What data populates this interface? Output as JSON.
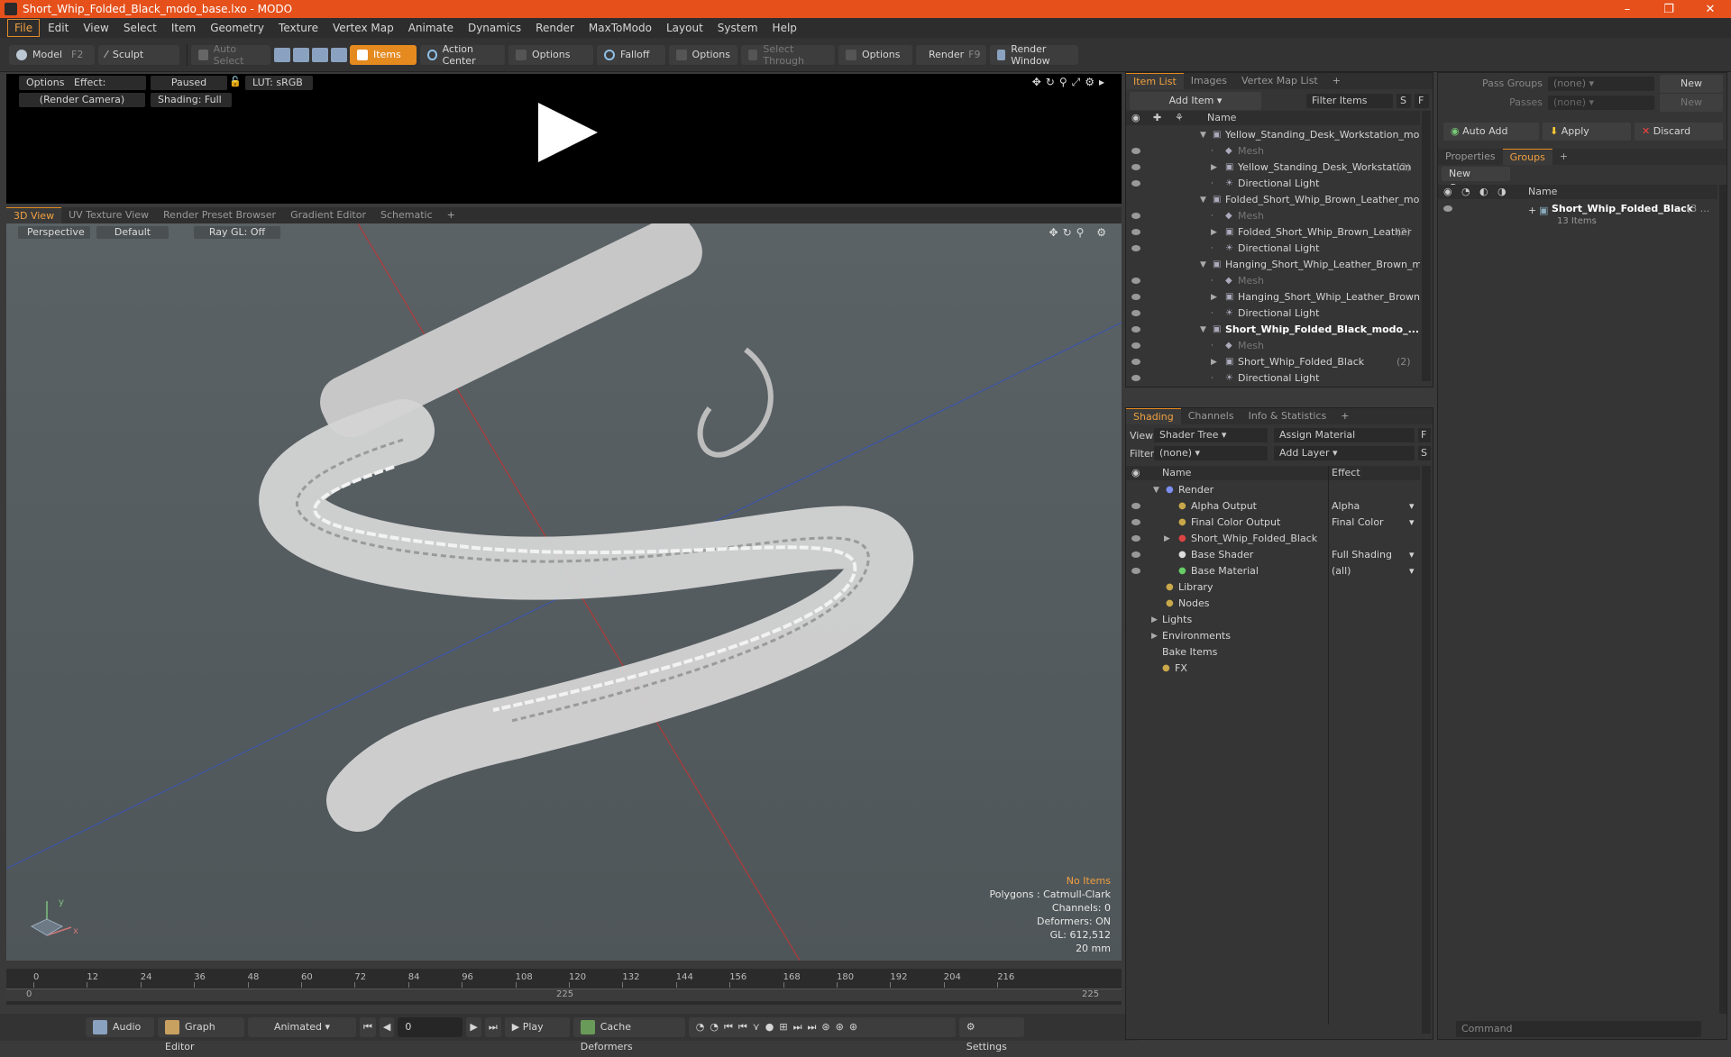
{
  "window": {
    "title": "Short_Whip_Folded_Black_modo_base.lxo - MODO",
    "controls": [
      "–",
      "❐",
      "✕"
    ]
  },
  "menu": [
    "File",
    "Edit",
    "View",
    "Select",
    "Item",
    "Geometry",
    "Texture",
    "Vertex Map",
    "Animate",
    "Dynamics",
    "Render",
    "MaxToModo",
    "Layout",
    "System",
    "Help"
  ],
  "toolbar": {
    "model": "Model",
    "model_key": "F2",
    "sculpt": "Sculpt",
    "auto_select": "Auto Select",
    "items": "Items",
    "action_center": "Action Center",
    "options1": "Options",
    "falloff": "Falloff",
    "options2": "Options",
    "select_through": "Select Through",
    "options3": "Options",
    "render": "Render",
    "render_key": "F9",
    "render_window": "Render Window"
  },
  "preview": {
    "options": "Options",
    "effect": "Effect: (Shadi...",
    "paused": "Paused",
    "lut": "LUT: sRGB",
    "camera": "(Render Camera)",
    "shading": "Shading: Full"
  },
  "view_tabs": [
    "3D View",
    "UV Texture View",
    "Render Preset Browser",
    "Gradient Editor",
    "Schematic",
    "+"
  ],
  "viewport": {
    "perspective": "Perspective",
    "default": "Default",
    "raygl": "Ray GL: Off",
    "stats": {
      "no_items": "No Items",
      "polygons": "Polygons : Catmull-Clark",
      "channels": "Channels: 0",
      "deformers": "Deformers: ON",
      "gl": "GL: 612,512",
      "scale": "20 mm"
    },
    "axis_x": "x",
    "axis_y": "y"
  },
  "timeline": {
    "ticks": [
      "0",
      "12",
      "24",
      "36",
      "48",
      "60",
      "72",
      "84",
      "96",
      "108",
      "120",
      "132",
      "144",
      "156",
      "168",
      "180",
      "192",
      "204",
      "216"
    ],
    "start": "0",
    "mid": "225",
    "end": "225"
  },
  "bottom": {
    "audio": "Audio",
    "graph_editor": "Graph Editor",
    "animated": "Animated",
    "frame": "0",
    "play": "Play",
    "cache_deformers": "Cache Deformers",
    "settings": "Settings"
  },
  "item_list": {
    "tabs": [
      "Item List",
      "Images",
      "Vertex Map List",
      "+"
    ],
    "add_item": "Add Item",
    "filter_items": "Filter Items",
    "s": "S",
    "f": "F",
    "col_name": "Name",
    "rows": [
      {
        "label": "Yellow_Standing_Desk_Workstation_mo ...",
        "indent": 1,
        "kind": "scene"
      },
      {
        "label": "Mesh",
        "indent": 2,
        "kind": "mesh"
      },
      {
        "label": "Yellow_Standing_Desk_Workstation",
        "count": "(2)",
        "indent": 2,
        "kind": "group"
      },
      {
        "label": "Directional Light",
        "indent": 2,
        "kind": "light"
      },
      {
        "label": "Folded_Short_Whip_Brown_Leather_mo ...",
        "indent": 1,
        "kind": "scene"
      },
      {
        "label": "Mesh",
        "indent": 2,
        "kind": "mesh"
      },
      {
        "label": "Folded_Short_Whip_Brown_Leather",
        "count": "(2)",
        "indent": 2,
        "kind": "group"
      },
      {
        "label": "Directional Light",
        "indent": 2,
        "kind": "light"
      },
      {
        "label": "Hanging_Short_Whip_Leather_Brown_m...",
        "indent": 1,
        "kind": "scene"
      },
      {
        "label": "Mesh",
        "indent": 2,
        "kind": "mesh"
      },
      {
        "label": "Hanging_Short_Whip_Leather_Brown",
        "indent": 2,
        "kind": "group"
      },
      {
        "label": "Directional Light",
        "indent": 2,
        "kind": "light"
      },
      {
        "label": "Short_Whip_Folded_Black_modo_...",
        "indent": 1,
        "kind": "scene",
        "bold": true
      },
      {
        "label": "Mesh",
        "indent": 2,
        "kind": "mesh"
      },
      {
        "label": "Short_Whip_Folded_Black",
        "count": "(2)",
        "indent": 2,
        "kind": "group"
      },
      {
        "label": "Directional Light",
        "indent": 2,
        "kind": "light"
      }
    ]
  },
  "shading": {
    "tabs": [
      "Shading",
      "Channels",
      "Info & Statistics",
      "+"
    ],
    "view_label": "View",
    "view_value": "Shader Tree",
    "assign_material": "Assign Material",
    "filter_label": "Filter",
    "filter_value": "(none)",
    "add_layer": "Add Layer",
    "f": "F",
    "s": "S",
    "col_name": "Name",
    "col_effect": "Effect",
    "rows": [
      {
        "label": "Render",
        "effect": "",
        "indent": 1
      },
      {
        "label": "Alpha Output",
        "effect": "Alpha",
        "indent": 2
      },
      {
        "label": "Final Color Output",
        "effect": "Final Color",
        "indent": 2
      },
      {
        "label": "Short_Whip_Folded_Black",
        "effect": "",
        "indent": 2
      },
      {
        "label": "Base Shader",
        "effect": "Full Shading",
        "indent": 2
      },
      {
        "label": "Base Material",
        "effect": "(all)",
        "indent": 2
      },
      {
        "label": "Library",
        "effect": "",
        "indent": 1
      },
      {
        "label": "Nodes",
        "effect": "",
        "indent": 1
      },
      {
        "label": "Lights",
        "effect": "",
        "indent": 0
      },
      {
        "label": "Environments",
        "effect": "",
        "indent": 0
      },
      {
        "label": "Bake Items",
        "effect": "",
        "indent": 0
      },
      {
        "label": "FX",
        "effect": "",
        "indent": 0
      }
    ]
  },
  "groups": {
    "pass_groups": "Pass Groups",
    "passes": "Passes",
    "none1": "(none)",
    "none2": "(none)",
    "new1": "New",
    "new2": "New",
    "auto_add": "Auto Add",
    "apply": "Apply",
    "discard": "Discard",
    "tabs": [
      "Properties",
      "Groups",
      "+"
    ],
    "new_group": "New Group",
    "col_name": "Name",
    "group_name": "Short_Whip_Folded_Black",
    "group_count": "(3 ...",
    "group_items": "13 Items",
    "command": "Command"
  },
  "colors": {
    "accent": "#e58a1f",
    "titlebar": "#e5501b"
  }
}
